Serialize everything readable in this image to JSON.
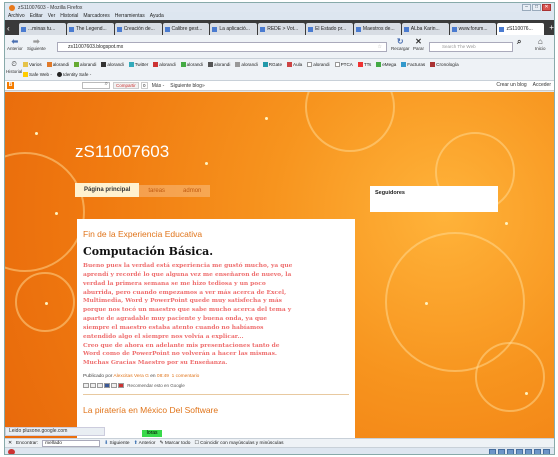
{
  "window": {
    "title": "zS11007603 - Mozilla Firefox",
    "controls": [
      "–",
      "□",
      "✕"
    ]
  },
  "menu": [
    "Archivo",
    "Editar",
    "Ver",
    "Historial",
    "Marcadores",
    "Herramientas",
    "Ayuda"
  ],
  "tabs": [
    {
      "label": "...minas tu..."
    },
    {
      "label": "The Legend..."
    },
    {
      "label": "Creación de..."
    },
    {
      "label": "Calibre gest..."
    },
    {
      "label": "La aplicació..."
    },
    {
      "label": "REDE > Vot..."
    },
    {
      "label": "El Estado pr..."
    },
    {
      "label": "Maestros de..."
    },
    {
      "label": "ALba Karin..."
    },
    {
      "label": "www.forum..."
    },
    {
      "label": "zS110076..."
    }
  ],
  "nav": {
    "back": "Anterior",
    "forward": "Siguiente",
    "url": "zs11007603.blogspot.mx",
    "reload": "Recargar",
    "stop": "Parar",
    "search_placeholder": "Search The Web",
    "home": "Inicio"
  },
  "bookmarks": {
    "historial": "Historial",
    "row1": [
      "Varios",
      "alorandi",
      "alorandi",
      "alorandi",
      "Twitter",
      "alorandi",
      "alorandi",
      "alorandi",
      "alorandi",
      "RGate",
      "Aula",
      "alorandi",
      "PTCA",
      "TTs",
      "eMega",
      "Facturas",
      "Cronología"
    ],
    "row2": [
      "Safe Web -",
      "Identity Safe -"
    ]
  },
  "blogger_bar": {
    "logo": "B",
    "share": "Compartir",
    "count": "0",
    "more": "Más -",
    "next": "Siguiente blog»",
    "create": "Crear un blog",
    "login": "Acceder"
  },
  "blog": {
    "title": "zS11007603",
    "tabs": [
      "Página principal",
      "tareas",
      "admon"
    ],
    "sidebar_title": "Seguidores",
    "post1": {
      "date_header": "Fin de la Experiencia Educativa",
      "title": "Computación Básica.",
      "lines": [
        "Bueno pues la verdad está experiencia me gustó mucho, ya que",
        "aprendí y recordé lo que alguna vez me enseñaron de nuevo, la",
        "verdad la primera semana se me hizo tediosa y un poco",
        "aburrida, pero cuando empezamos a ver más acerca de Excel,",
        "Multimedia, Word y PowerPoint quede muy satisfecha y más",
        "porque nos tocó un maestro que sabe mucho acerca del tema y",
        "aparte de agradable muy paciente y buena onda, ya que",
        "siempre el maestro estaba atento cuando no habíamos",
        "entendido algo el siempre nos volvía a explicar...",
        "Creo que de ahora en adelante mis presentaciones tanto de",
        "Word como de PowerPoint no volverán a hacer las mismas.",
        "Muchas Gracias Maestro por su Enseñanza."
      ],
      "posted_by_label": "Publicado por",
      "author": "Alexcitas Vera G",
      "at_label": "en",
      "time": "08:49",
      "comments": "1 comentario",
      "recommend": "Recomendar esto en Google"
    },
    "post2_title": "La piratería en México Del Software"
  },
  "status_url": "Leido plusone.google.com",
  "findbar": {
    "close": "✕",
    "label": "Encontrar:",
    "value": "mellado",
    "next": "Siguiente",
    "prev": "Anterior",
    "highlight": "Marcar todo",
    "match_case": "Coincidir con mayúsculas y minúsculas"
  },
  "find_highlight": "Ioras",
  "colors": {
    "page_orange": "#f7941e",
    "link_orange": "#e0741a",
    "post_text": "#ee6e6e"
  }
}
